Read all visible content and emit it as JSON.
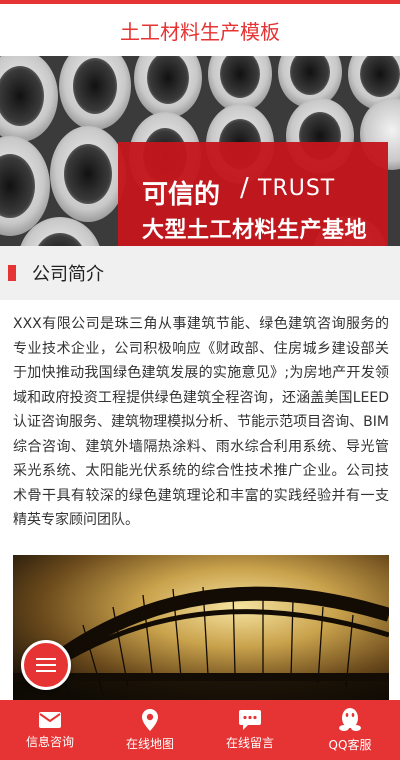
{
  "header": {
    "title": "土工材料生产模板"
  },
  "banner": {
    "slogan_cn": "可信的",
    "slash": "/",
    "slogan_en": "TRUST",
    "slogan_sub": "大型土工材料生产基地",
    "slides_total": 2,
    "active_slide": 1
  },
  "section": {
    "title": "公司简介"
  },
  "intro": {
    "text": "XXX有限公司是珠三角从事建筑节能、绿色建筑咨询服务的专业技术企业，公司积极响应《财政部、住房城乡建设部关于加快推动我国绿色建筑发展的实施意见》;为房地产开发领域和政府投资工程提供绿色建筑全程咨询，还涵盖美国LEED认证咨询服务、建筑物理模拟分析、节能示范项目咨询、BIM综合咨询、建筑外墙隔热涂料、雨水综合利用系统、导光管采光系统、太阳能光伏系统的综合性技术推广企业。公司技术骨干具有较深的绿色建筑理论和丰富的实践经验并有一支精英专家顾问团队。"
  },
  "footer": {
    "items": [
      {
        "label": "信息咨询",
        "icon": "mail-icon"
      },
      {
        "label": "在线地图",
        "icon": "map-pin-icon"
      },
      {
        "label": "在线留言",
        "icon": "chat-icon"
      },
      {
        "label": "QQ客服",
        "icon": "qq-icon"
      }
    ]
  },
  "colors": {
    "accent": "#e63333",
    "banner_box": "#c4161c"
  }
}
